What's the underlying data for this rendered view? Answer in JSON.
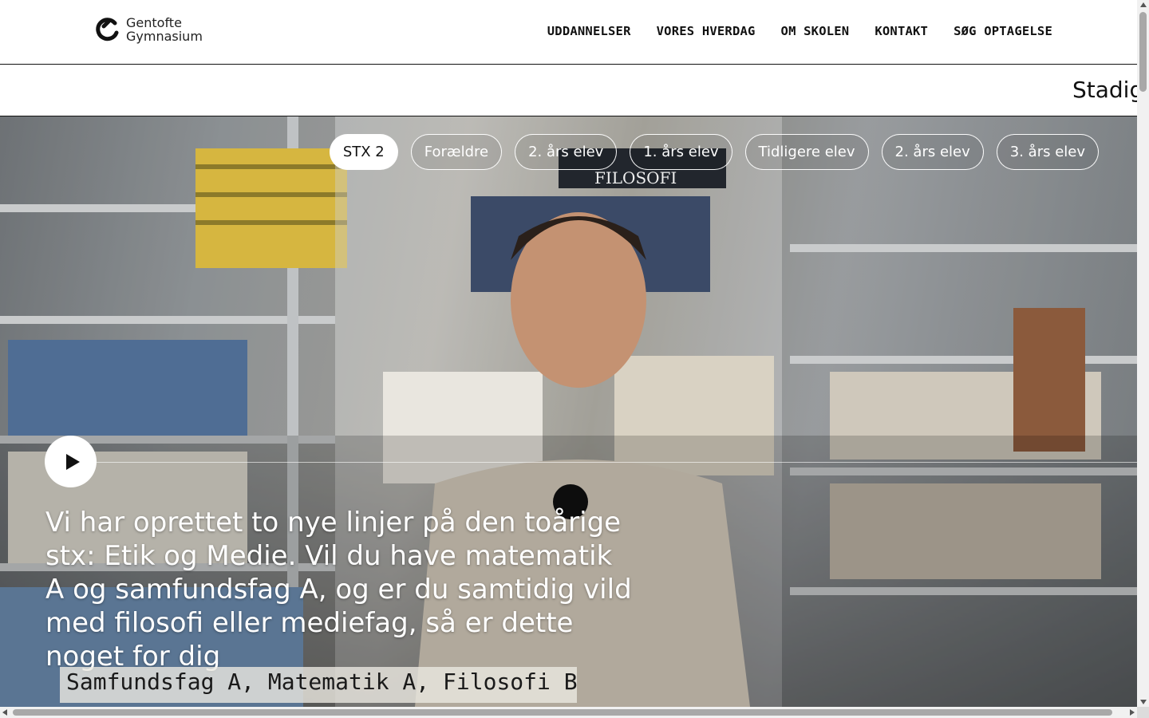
{
  "logo": {
    "line1": "Gentofte",
    "line2": "Gymnasium",
    "icon": "gentofte-logo-icon"
  },
  "nav": {
    "items": [
      "UDDANNELSER",
      "VORES HVERDAG",
      "OM SKOLEN",
      "KONTAKT",
      "SØG OPTAGELSE"
    ]
  },
  "ticker": {
    "text": "Stadig"
  },
  "hero": {
    "chips": [
      "STX 2",
      "Forældre",
      "2. års elev",
      "1. års elev",
      "Tidligere elev",
      "2. års elev",
      "3. års elev"
    ],
    "active_chip": "STX 2",
    "play_icon": "play-icon",
    "caption": "Vi har oprettet to nye linjer på den toårige stx: Etik og Medie. Vil du have matematik A og samfundsfag A, og er du samtidig vild med filosofi eller mediefag, så er dette noget for dig",
    "subtitle": "Samfundsfag A, Matematik A, Filosofi B",
    "book_label": "FILOSOFI"
  },
  "colors": {
    "text": "#111111",
    "chip_border": "#ffffff",
    "background": "#ffffff"
  }
}
